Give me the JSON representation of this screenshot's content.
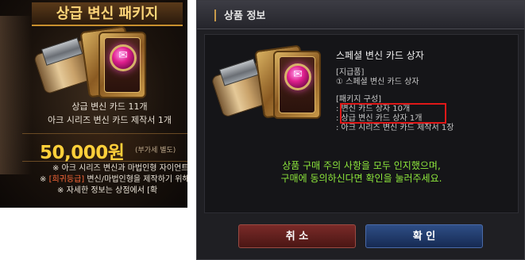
{
  "shop_card": {
    "title": "상급 변신 패키지",
    "line1": "상급 변신 카드 11개",
    "line2": "아크 시리즈 변신 카드 제작서 1개",
    "price": "50,000원",
    "price_note": "(부가세 별도)",
    "notes": [
      {
        "prefix": "※ ",
        "highlight": "",
        "text": "아크 시리즈 변신과 마법인형 자이언트"
      },
      {
        "prefix": "※ ",
        "highlight": "[희귀등급]",
        "text": " 변신/마법인형을 제작하기 위해"
      },
      {
        "prefix": "※ ",
        "highlight": "",
        "text": "자세한 정보는 상점에서 [확"
      }
    ]
  },
  "dialog": {
    "title": "상품 정보",
    "product_name": "스페셜 변신 카드 상자",
    "given_label": "[지급품]",
    "given_item": "① 스페셜 변신 카드 상자",
    "package_label": "[패키지 구성]",
    "package_items": [
      ": 변신 카드 상자 10개",
      ": 상급 변신 카드 상자 1개",
      ": 아크 시리즈 변신 카드 제작서 1장"
    ],
    "confirm_line1": "상품 구매 주의 사항을 모두 인지했으며,",
    "confirm_line2": "구매에 동의하신다면 확인을 눌러주세요.",
    "cancel_label": "취 소",
    "ok_label": "확 인"
  },
  "colors": {
    "price": "#ffcf3a",
    "confirm_text": "#8ee83c",
    "highlight_box": "#e01818",
    "cancel_button": "#7a2a28",
    "ok_button": "#2e4e86"
  }
}
